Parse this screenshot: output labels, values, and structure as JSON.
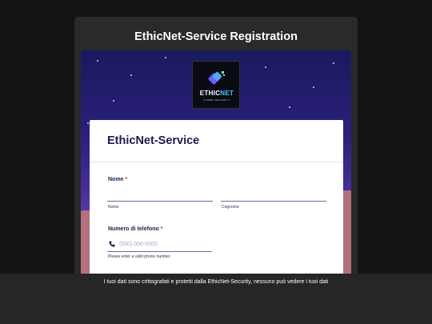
{
  "page": {
    "title": "EthicNet-Service Registration"
  },
  "logo": {
    "text_main": "ETHIC",
    "text_accent": "NET",
    "tagline": "CYBER SECURITY"
  },
  "form": {
    "title": "EthicNet-Service",
    "name_field": {
      "label": "Nome",
      "required_mark": "*",
      "first_sublabel": "Nome",
      "last_sublabel": "Cognome",
      "first_value": "",
      "last_value": ""
    },
    "phone_field": {
      "label": "Numero di telefono",
      "required_mark": "*",
      "placeholder": "(000) 000-0000",
      "help_text": "Please enter a valid phone number.",
      "icon": "phone-icon"
    }
  },
  "banner": {
    "text": "I tuoi dati sono crittografati e protetti dalla EthicNet-Security, nessuno può vedere i tuoi dati"
  },
  "colors": {
    "background": "#141414",
    "card": "#2a2a2a",
    "form_title": "#1d1a4f",
    "required": "#d02a2a",
    "logo_accent": "#42c6ff"
  }
}
